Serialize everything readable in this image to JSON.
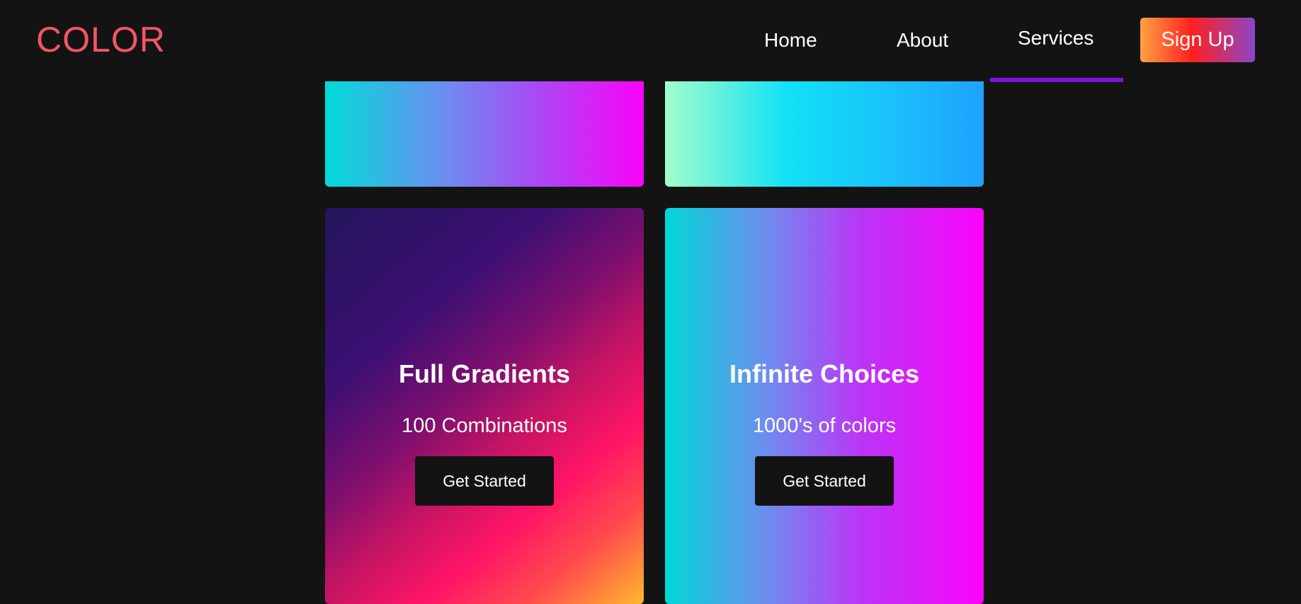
{
  "header": {
    "logo": "COLOR",
    "nav": {
      "home": "Home",
      "about": "About",
      "services": "Services",
      "active": "Services"
    },
    "signup_label": "Sign Up"
  },
  "cards": [
    {
      "title": "Full Gradients",
      "subtitle": "100 Combinations",
      "button_label": "Get Started"
    },
    {
      "title": "Infinite Choices",
      "subtitle": "1000's of colors",
      "button_label": "Get Started"
    }
  ],
  "colors": {
    "background": "#131313",
    "logo": "#f25565",
    "active_underline": "#7a14e0"
  }
}
